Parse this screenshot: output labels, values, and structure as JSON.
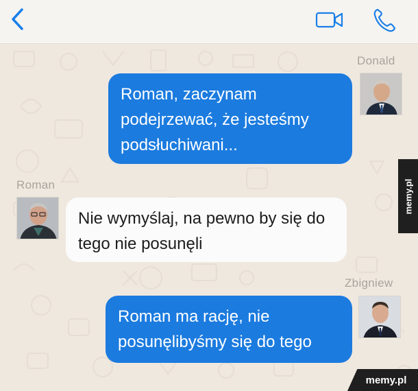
{
  "header": {
    "back_icon": "chevron-left-icon",
    "video_icon": "video-camera-icon",
    "call_icon": "phone-icon",
    "accent": "#1a7fe8"
  },
  "messages": [
    {
      "sender": "Donald",
      "direction": "outgoing",
      "text": "Roman, zaczynam podejrzewać, że jesteśmy podsłuchiwani..."
    },
    {
      "sender": "Roman",
      "direction": "incoming",
      "text": "Nie wymyślaj, na pewno by się do tego nie posunęli"
    },
    {
      "sender": "Zbigniew",
      "direction": "outgoing",
      "text": "Roman ma rację, nie posunęlibyśmy się do tego"
    }
  ],
  "watermark": {
    "side": "memy.pl",
    "corner": "memy.pl"
  },
  "colors": {
    "outgoing_bubble": "#1b7bdf",
    "incoming_bubble": "#fbfbfb",
    "background": "#efe8df"
  }
}
